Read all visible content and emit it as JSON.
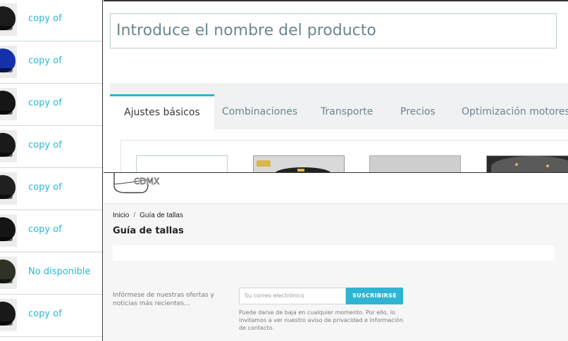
{
  "product_list": {
    "items": [
      {
        "label": "copy of",
        "thumb_color": "#1b1b1b"
      },
      {
        "label": "copy of",
        "thumb_color": "#1530a8"
      },
      {
        "label": "copy of",
        "thumb_color": "#161616"
      },
      {
        "label": "copy of",
        "thumb_color": "#1a1a1a"
      },
      {
        "label": "copy of",
        "thumb_color": "#202020"
      },
      {
        "label": "copy of",
        "thumb_color": "#151515"
      },
      {
        "label": "No disponible",
        "thumb_color": "#2e3326"
      },
      {
        "label": "copy of",
        "thumb_color": "#191919"
      }
    ]
  },
  "editor": {
    "name_placeholder": "Introduce el nombre del producto",
    "tabs": [
      {
        "label": "Ajustes básicos"
      },
      {
        "label": "Combinaciones"
      },
      {
        "label": "Transporte"
      },
      {
        "label": "Precios"
      },
      {
        "label": "Optimización motores"
      }
    ],
    "accent": "#25b9d7"
  },
  "size_guide": {
    "logo_text": "CDMX",
    "breadcrumb": {
      "home": "Inicio",
      "separator": "/",
      "current": "Guía de tallas"
    },
    "title": "Guía de tallas",
    "newsletter": {
      "description": "Infórmese de nuestras ofertas y noticias más recientes…",
      "email_placeholder": "Su correo electrónico",
      "subscribe_label": "SUSCRIBIRSE",
      "privacy_note": "Puede darse de baja en cualquier momento. Por ello, lo invitamos a ver nuestro aviso de privacidad e información de contacto."
    }
  }
}
